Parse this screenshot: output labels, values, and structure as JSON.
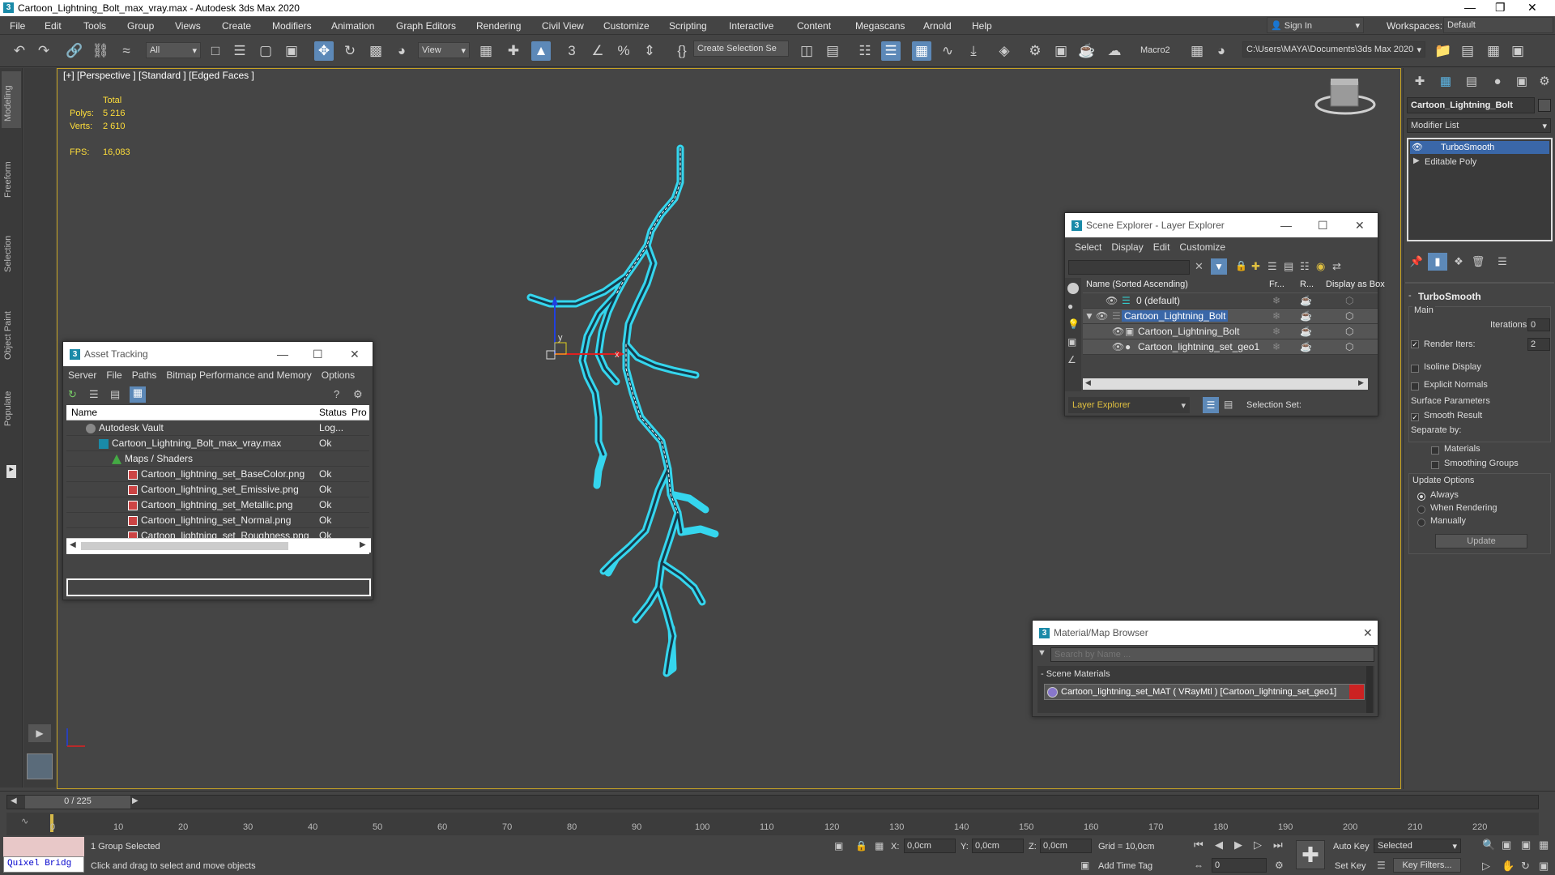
{
  "window": {
    "title": "Cartoon_Lightning_Bolt_max_vray.max - Autodesk 3ds Max 2020",
    "app_icon": "3"
  },
  "menu": [
    "File",
    "Edit",
    "Tools",
    "Group",
    "Views",
    "Create",
    "Modifiers",
    "Animation",
    "Graph Editors",
    "Rendering",
    "Civil View",
    "Customize",
    "Scripting",
    "Interactive",
    "Content",
    "Megascans",
    "Arnold",
    "Help"
  ],
  "account": {
    "sign_in": "Sign In",
    "workspaces_label": "Workspaces:",
    "workspace": "Default"
  },
  "toolbar": {
    "filter": "All",
    "view": "View",
    "selection_set": "Create Selection Se",
    "macro": "Macro2",
    "path": "C:\\Users\\MAYA\\Documents\\3ds Max 2020"
  },
  "viewport": {
    "label": "[+] [Perspective ] [Standard ] [Edged Faces ]",
    "total_label": "Total",
    "polys_label": "Polys:",
    "polys": "5 216",
    "verts_label": "Verts:",
    "verts": "2 610",
    "fps_label": "FPS:",
    "fps": "16,083",
    "gizmo_x": "x",
    "gizmo_y": "y"
  },
  "asset_tracking": {
    "title": "Asset Tracking",
    "menu": [
      "Server",
      "File",
      "Paths",
      "Bitmap Performance and Memory",
      "Options"
    ],
    "columns": [
      "Name",
      "Status",
      "Pro"
    ],
    "rows": [
      {
        "name": "Autodesk Vault",
        "status": "Log..."
      },
      {
        "name": "Cartoon_Lightning_Bolt_max_vray.max",
        "status": "Ok"
      },
      {
        "name": "Maps / Shaders",
        "status": ""
      },
      {
        "name": "Cartoon_lightning_set_BaseColor.png",
        "status": "Ok"
      },
      {
        "name": "Cartoon_lightning_set_Emissive.png",
        "status": "Ok"
      },
      {
        "name": "Cartoon_lightning_set_Metallic.png",
        "status": "Ok"
      },
      {
        "name": "Cartoon_lightning_set_Normal.png",
        "status": "Ok"
      },
      {
        "name": "Cartoon_lightning_set_Roughness.png",
        "status": "Ok"
      }
    ]
  },
  "scene_explorer": {
    "title": "Scene Explorer - Layer Explorer",
    "menu": [
      "Select",
      "Display",
      "Edit",
      "Customize"
    ],
    "columns": [
      "Name (Sorted Ascending)",
      "Fr...",
      "R...",
      "Display as Box"
    ],
    "rows": [
      "0 (default)",
      "Cartoon_Lightning_Bolt",
      "Cartoon_Lightning_Bolt",
      "Cartoon_lightning_set_geo1"
    ],
    "footer_dropdown": "Layer Explorer",
    "selection_set_label": "Selection Set:"
  },
  "material_browser": {
    "title": "Material/Map Browser",
    "search_placeholder": "Search by Name ...",
    "section": "- Scene Materials",
    "item": "Cartoon_lightning_set_MAT ( VRayMtl ) [Cartoon_lightning_set_geo1]"
  },
  "command_panel": {
    "object_name": "Cartoon_Lightning_Bolt",
    "modifier_list": "Modifier List",
    "stack": [
      "TurboSmooth",
      "Editable Poly"
    ],
    "rollout": "TurboSmooth",
    "main_label": "Main",
    "iterations_label": "Iterations:",
    "iterations": "0",
    "render_iters_label": "Render Iters:",
    "render_iters": "2",
    "isoline": "Isoline Display",
    "explicit_normals": "Explicit Normals",
    "surface_params": "Surface Parameters",
    "smooth_result": "Smooth Result",
    "separate_by": "Separate by:",
    "materials": "Materials",
    "smoothing_groups": "Smoothing Groups",
    "update_options": "Update Options",
    "always": "Always",
    "when_rendering": "When Rendering",
    "manually": "Manually",
    "update_button": "Update"
  },
  "left_tabs": [
    "Modeling",
    "Freeform",
    "Selection",
    "Object Paint",
    "Populate"
  ],
  "timeline": {
    "frame_counter": "0 / 225",
    "ticks": [
      "0",
      "10",
      "20",
      "30",
      "40",
      "50",
      "60",
      "70",
      "80",
      "90",
      "100",
      "110",
      "120",
      "130",
      "140",
      "150",
      "160",
      "170",
      "180",
      "190",
      "200",
      "210",
      "220"
    ]
  },
  "status": {
    "quixel": "Quixel Bridg",
    "selection": "1 Group Selected",
    "prompt": "Click and drag to select and move objects",
    "x_label": "X:",
    "x": "0,0cm",
    "y_label": "Y:",
    "y": "0,0cm",
    "z_label": "Z:",
    "z": "0,0cm",
    "grid": "Grid = 10,0cm",
    "add_time_tag": "Add Time Tag",
    "auto_key": "Auto Key",
    "set_key": "Set Key",
    "selected": "Selected",
    "key_filters": "Key Filters...",
    "frame": "0"
  }
}
